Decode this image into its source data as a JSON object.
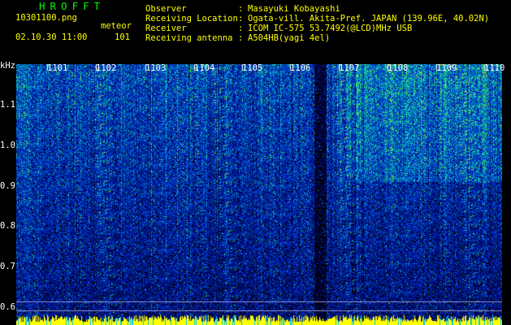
{
  "header": {
    "brand": "HROFFT",
    "filename": "10301100.png",
    "datetime": "02.10.30 11:00",
    "mode_label": "meteor",
    "count": "101"
  },
  "info": {
    "rows": [
      {
        "label": "Observer",
        "sep": ":",
        "value": "Masayuki Kobayashi"
      },
      {
        "label": "Receiving Location",
        "sep": ":",
        "value": "Ogata-vill. Akita-Pref. JAPAN (139.96E, 40.02N)"
      },
      {
        "label": "Receiver",
        "sep": ":",
        "value": "ICOM IC-575 53.7492(@LCD)MHz USB"
      },
      {
        "label": "Receiving antenna",
        "sep": ":",
        "value": "A504HB(yagi 4el)"
      }
    ]
  },
  "axis": {
    "y_unit": "kHz",
    "y_ticks": [
      "1.1",
      "1.0",
      "0.9",
      "0.8",
      "0.7",
      "0.6"
    ],
    "x_ticks": [
      "1101",
      "1102",
      "1103",
      "1104",
      "1105",
      "1106",
      "1107",
      "1108",
      "1109",
      "1110"
    ]
  },
  "colors": {
    "brand": "#00ff00",
    "text": "#ffffff",
    "highlight": "#ffff00",
    "background": "#000000"
  }
}
